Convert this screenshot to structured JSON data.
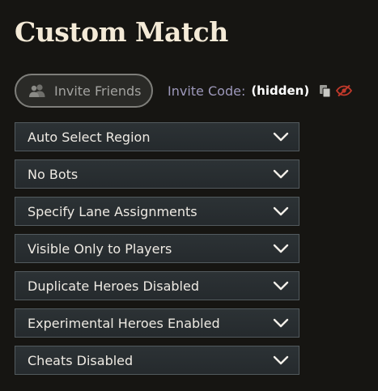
{
  "page": {
    "title": "Custom Match"
  },
  "invite": {
    "button_label": "Invite Friends",
    "button_icon": "people-icon",
    "code_label": "Invite Code:",
    "code_value": "(hidden)",
    "copy_icon": "copy-icon",
    "reveal_icon": "eye-hidden-icon"
  },
  "options": [
    {
      "label": "Auto Select Region"
    },
    {
      "label": "No Bots"
    },
    {
      "label": "Specify Lane Assignments"
    },
    {
      "label": "Visible Only to Players"
    },
    {
      "label": "Duplicate Heroes Disabled"
    },
    {
      "label": "Experimental Heroes Enabled"
    },
    {
      "label": "Cheats Disabled"
    }
  ],
  "colors": {
    "background": "#161512",
    "title": "#f4ead7",
    "code_label": "#9d98ba",
    "hide_icon": "#c0392b"
  }
}
